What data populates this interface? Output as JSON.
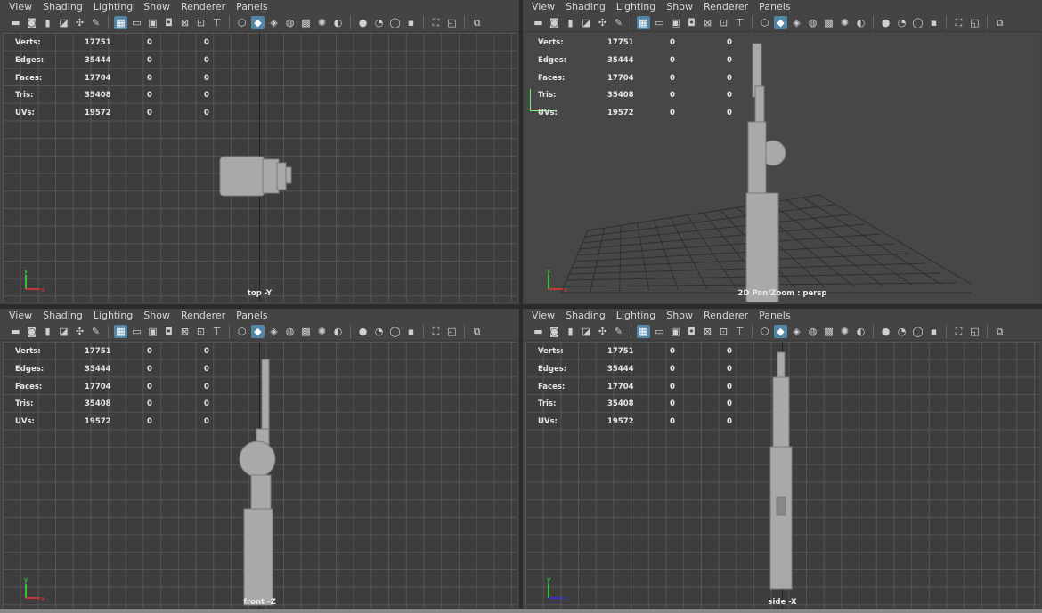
{
  "menus": [
    "View",
    "Shading",
    "Lighting",
    "Show",
    "Renderer",
    "Panels"
  ],
  "hud": {
    "rows": [
      {
        "label": "Verts:",
        "v1": "17751",
        "v2": "0",
        "v3": "0"
      },
      {
        "label": "Edges:",
        "v1": "35444",
        "v2": "0",
        "v3": "0"
      },
      {
        "label": "Faces:",
        "v1": "17704",
        "v2": "0",
        "v3": "0"
      },
      {
        "label": "Tris:",
        "v1": "35408",
        "v2": "0",
        "v3": "0"
      },
      {
        "label": "UVs:",
        "v1": "19572",
        "v2": "0",
        "v3": "0"
      }
    ]
  },
  "panels": [
    {
      "camera": "top -Y",
      "axis_up": "y",
      "axis_side": "x"
    },
    {
      "camera": "2D Pan/Zoom : persp",
      "axis_up": "y",
      "axis_side": "x"
    },
    {
      "camera": "front -Z",
      "axis_up": "y",
      "axis_side": "x"
    },
    {
      "camera": "side -X",
      "axis_up": "y",
      "axis_side": "z"
    }
  ],
  "toolbar_icons": [
    "camera-select-icon",
    "camera-attributes-icon",
    "bookmark-icon",
    "image-plane-icon",
    "2d-pan-zoom-icon",
    "grease-pencil-icon",
    "separator",
    "grid-icon",
    "film-gate-icon",
    "resolution-gate-icon",
    "gate-mask-icon",
    "field-chart-icon",
    "safe-action-icon",
    "safe-title-icon",
    "separator",
    "wireframe-icon",
    "smooth-shade-icon",
    "wireframe-on-shaded-icon",
    "default-material-icon",
    "textured-icon",
    "use-lights-icon",
    "shadows-icon",
    "separator",
    "screen-space-ao-icon",
    "motion-blur-icon",
    "multisample-aa-icon",
    "depth-of-field-icon",
    "separator",
    "isolate-select-icon",
    "xray-icon",
    "separator",
    "panel-layout-icon"
  ],
  "colors": {
    "accent": "#5285a6",
    "axis_x": "#e33",
    "axis_y": "#3e3",
    "axis_z": "#33e"
  }
}
